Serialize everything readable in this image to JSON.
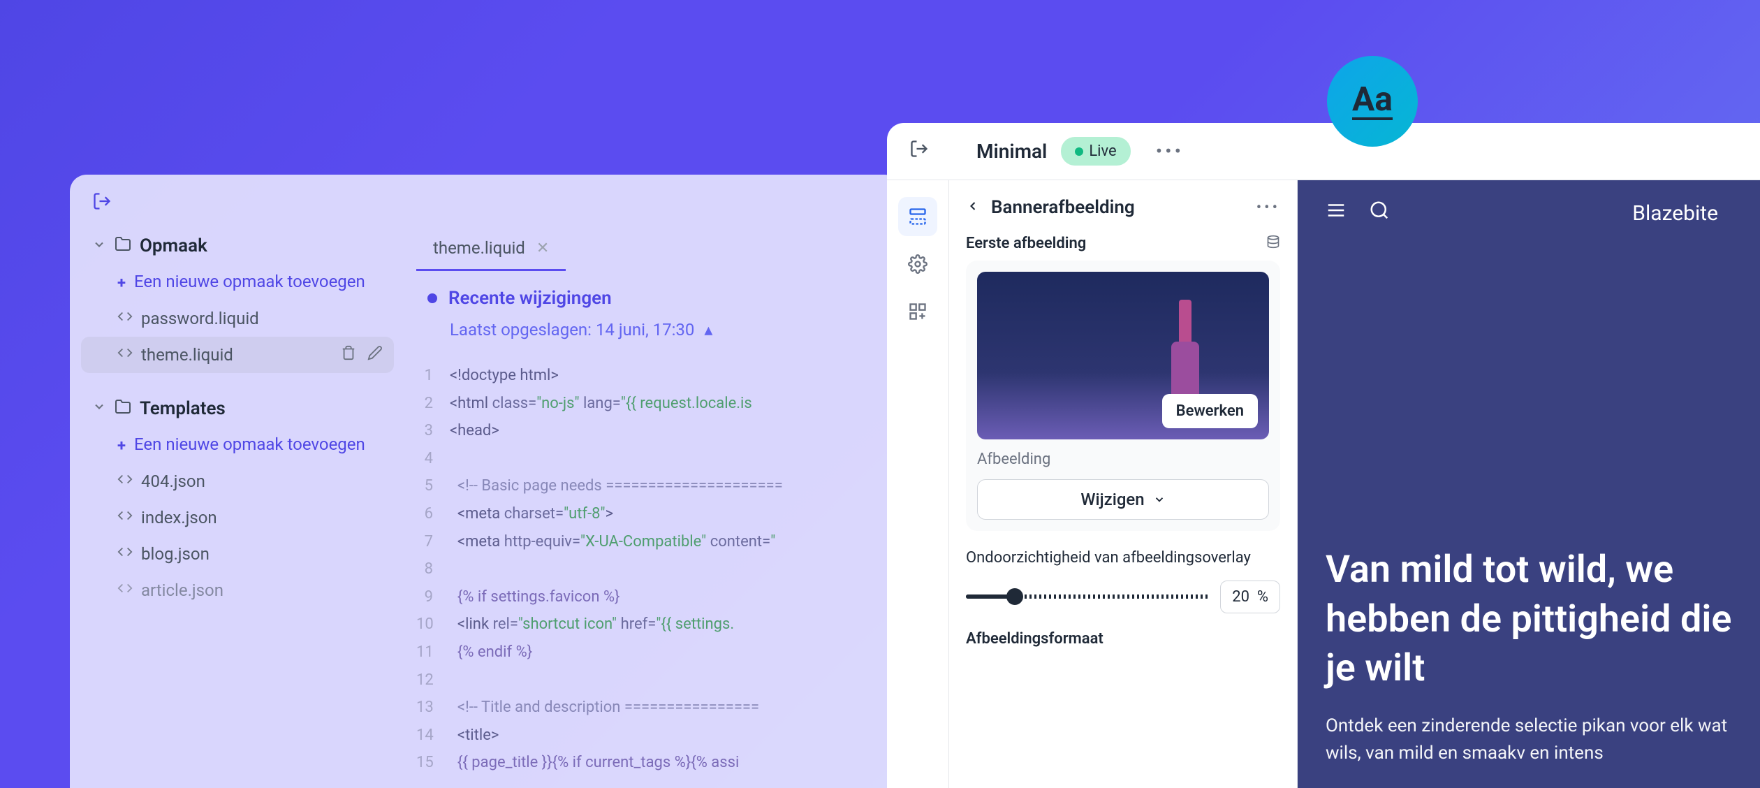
{
  "editor": {
    "sidebar": {
      "section1": {
        "title": "Opmaak",
        "addText": "Een nieuwe opmaak toevoegen",
        "files": [
          "password.liquid",
          "theme.liquid"
        ]
      },
      "section2": {
        "title": "Templates",
        "addText": "Een nieuwe opmaak toevoegen",
        "files": [
          "404.json",
          "index.json",
          "blog.json",
          "article.json"
        ]
      }
    },
    "tab": "theme.liquid",
    "recentTitle": "Recente wijzigingen",
    "savedAt": "Laatst opgeslagen: 14 juni, 17:30",
    "code": [
      {
        "n": 1,
        "html": "<span class='code-tag'>&lt;!doctype html&gt;</span>"
      },
      {
        "n": 2,
        "html": "<span class='code-tag'>&lt;html</span> <span class='code-attr'>class=</span><span class='code-string'>\"no-js\"</span> <span class='code-attr'>lang=</span><span class='code-string'>\"{{ request.locale.is</span>"
      },
      {
        "n": 3,
        "html": "<span class='code-tag'>&lt;head&gt;</span>"
      },
      {
        "n": 4,
        "html": ""
      },
      {
        "n": 5,
        "html": "  <span class='code-comment'>&lt;!-- Basic page needs =====================</span>"
      },
      {
        "n": 6,
        "html": "  <span class='code-tag'>&lt;meta</span> <span class='code-attr'>charset=</span><span class='code-string'>\"utf-8\"</span><span class='code-tag'>&gt;</span>"
      },
      {
        "n": 7,
        "html": "  <span class='code-tag'>&lt;meta</span> <span class='code-attr'>http-equiv=</span><span class='code-string'>\"X-UA-Compatible\"</span> <span class='code-attr'>content=</span><span class='code-string'>\"</span>"
      },
      {
        "n": 8,
        "html": ""
      },
      {
        "n": 9,
        "html": "  <span class='code-liquid'>{% if settings.favicon %}</span>"
      },
      {
        "n": 10,
        "html": "  <span class='code-tag'>&lt;link</span> <span class='code-attr'>rel=</span><span class='code-string'>\"shortcut icon\"</span> <span class='code-attr'>href=</span><span class='code-string'>\"{{ settings.</span>"
      },
      {
        "n": 11,
        "html": "  <span class='code-liquid'>{% endif %}</span>"
      },
      {
        "n": 12,
        "html": ""
      },
      {
        "n": 13,
        "html": "  <span class='code-comment'>&lt;!-- Title and description ================</span>"
      },
      {
        "n": 14,
        "html": "  <span class='code-tag'>&lt;title&gt;</span>"
      },
      {
        "n": 15,
        "html": "  <span class='code-liquid'>{{ page_title }}{% if current_tags %}{% assi</span>"
      }
    ]
  },
  "designer": {
    "title": "Minimal",
    "status": "Live",
    "panelTitle": "Bannerafbeelding",
    "firstImageLabel": "Eerste afbeelding",
    "editBtn": "Bewerken",
    "imageLabel": "Afbeelding",
    "changeBtn": "Wijzigen",
    "opacityLabel": "Ondoorzichtigheid van afbeeldingsoverlay",
    "opacityValue": "20",
    "opacityUnit": "%",
    "formatLabel": "Afbeeldingsformaat"
  },
  "preview": {
    "brand": "Blazebite",
    "heading": "Van mild tot wild, we hebben de pittigheid die je wilt",
    "subtext": "Ontdek een zinderende selectie pikan voor elk wat wils, van mild en smaakv en intens"
  },
  "aa": "Aa"
}
